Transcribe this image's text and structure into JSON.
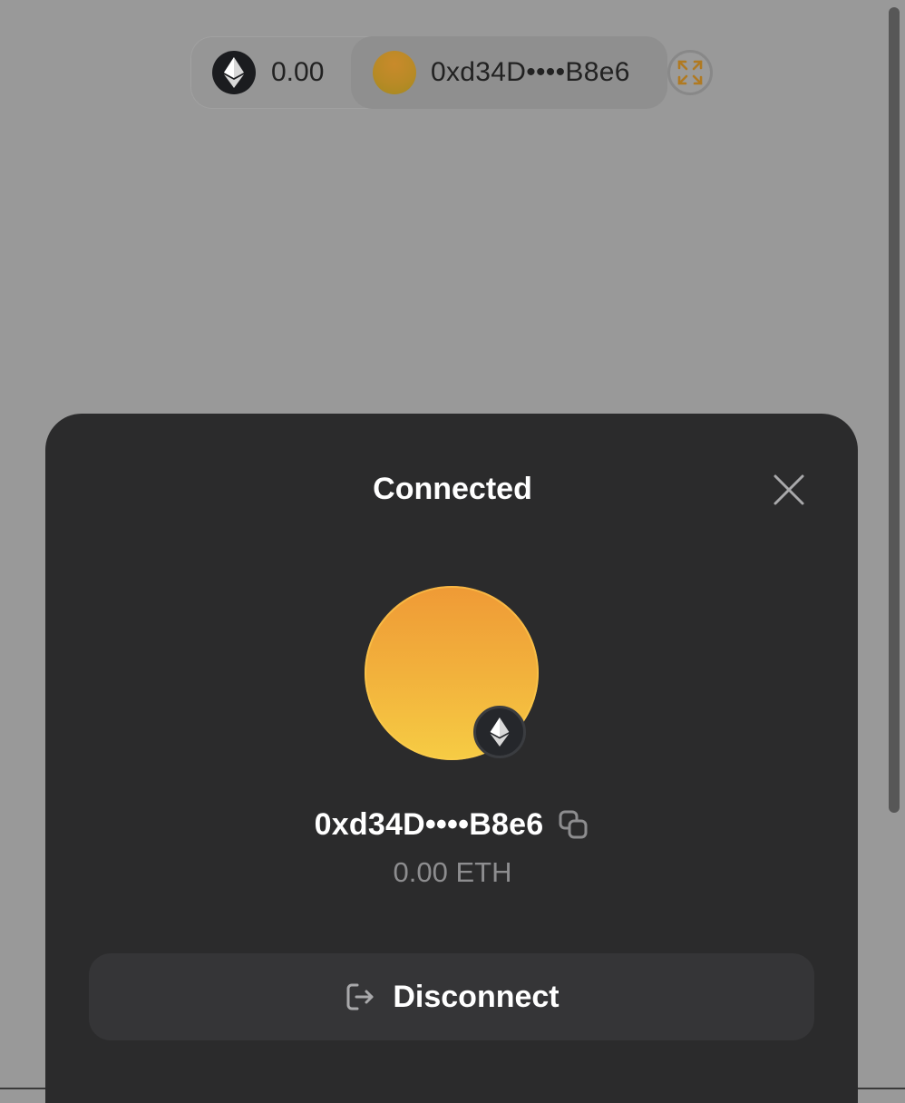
{
  "top_bar": {
    "balance": "0.00",
    "address": "0xd34D••••B8e6",
    "network_icon": "ethereum-icon",
    "expand_icon": "expand-icon"
  },
  "modal": {
    "title": "Connected",
    "close_icon": "close-icon",
    "address": "0xd34D••••B8e6",
    "copy_icon": "copy-icon",
    "balance": "0.00 ETH",
    "network_badge_icon": "ethereum-icon",
    "disconnect_label": "Disconnect",
    "disconnect_icon": "logout-icon"
  },
  "colors": {
    "modal_background": "#2b2b2c",
    "button_background": "#353537",
    "avatar_gradient_top": "#ef9a36",
    "avatar_gradient_bottom": "#f6cc44",
    "overlay": "#999999"
  }
}
